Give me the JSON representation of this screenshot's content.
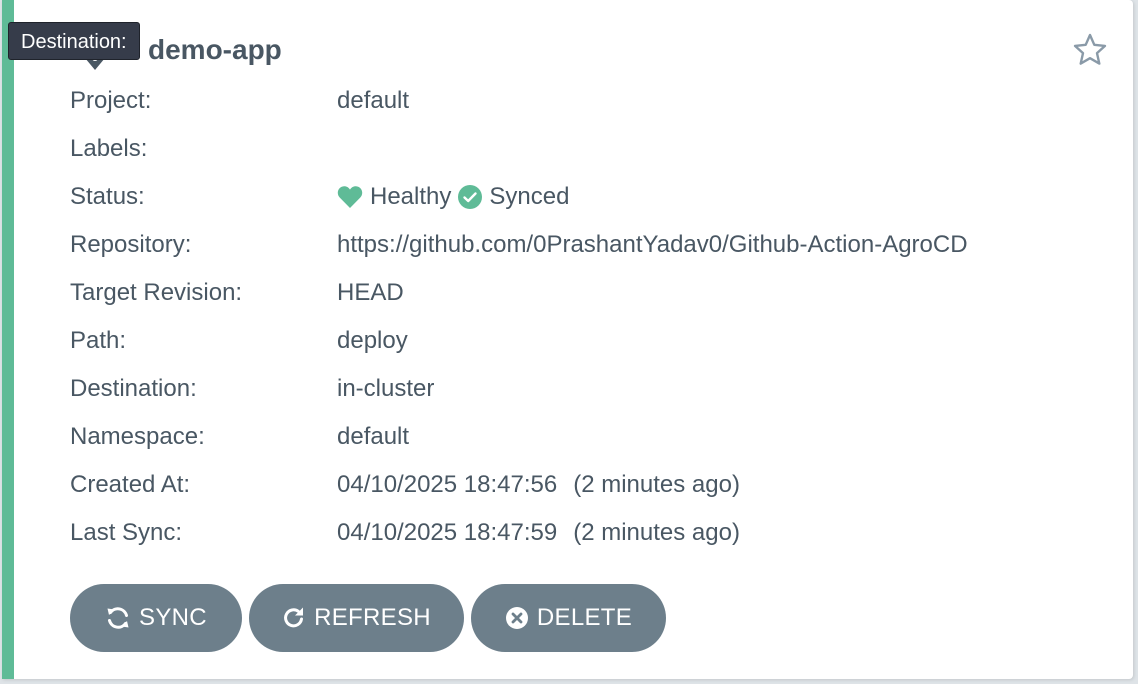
{
  "app": {
    "name": "demo-app",
    "favorite_icon": "star-outline-icon"
  },
  "tooltip": {
    "text": "Destination:"
  },
  "fields": {
    "project": {
      "label": "Project:",
      "value": "default"
    },
    "labels": {
      "label": "Labels:",
      "value": ""
    },
    "status": {
      "label": "Status:",
      "health": "Healthy",
      "health_icon": "heart-icon",
      "health_color": "#5fbb97",
      "sync": "Synced",
      "sync_icon": "check-circle-icon",
      "sync_color": "#5fbb97"
    },
    "repository": {
      "label": "Repository:",
      "value": "https://github.com/0PrashantYadav0/Github-Action-AgroCD"
    },
    "target_revision": {
      "label": "Target Revision:",
      "value": "HEAD"
    },
    "path": {
      "label": "Path:",
      "value": "deploy"
    },
    "destination": {
      "label": "Destination:",
      "value": "in-cluster"
    },
    "namespace": {
      "label": "Namespace:",
      "value": "default"
    },
    "created_at": {
      "label": "Created At:",
      "value": "04/10/2025 18:47:56",
      "ago": "(2 minutes ago)"
    },
    "last_sync": {
      "label": "Last Sync:",
      "value": "04/10/2025 18:47:59",
      "ago": "(2 minutes ago)"
    }
  },
  "actions": {
    "sync": {
      "label": "SYNC",
      "icon": "sync-icon"
    },
    "refresh": {
      "label": "REFRESH",
      "icon": "redo-icon"
    },
    "delete": {
      "label": "DELETE",
      "icon": "times-circle-icon"
    }
  },
  "colors": {
    "health_bar": "#5fbb97",
    "button_bg": "#6d7f8b",
    "text": "#495763"
  }
}
